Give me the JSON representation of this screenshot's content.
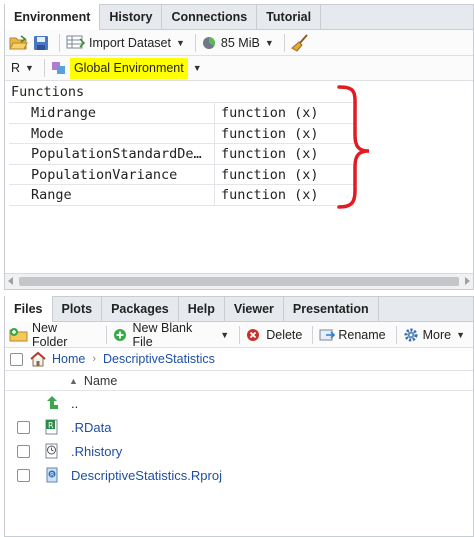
{
  "env_pane": {
    "tabs": [
      {
        "label": "Environment",
        "active": true
      },
      {
        "label": "History",
        "active": false
      },
      {
        "label": "Connections",
        "active": false
      },
      {
        "label": "Tutorial",
        "active": false
      }
    ],
    "toolbar": {
      "open_icon": "open-folder-icon",
      "save_icon": "save-icon",
      "import_label": "Import Dataset",
      "memory_label": "85 MiB",
      "broom_icon": "broom-icon"
    },
    "language_label": "R",
    "environment_label": "Global Environment",
    "section_header": "Functions",
    "objects": [
      {
        "name": "Midrange",
        "value": "function (x)"
      },
      {
        "name": "Mode",
        "value": "function (x)"
      },
      {
        "name": "PopulationStandardDe…",
        "value": "function (x)"
      },
      {
        "name": "PopulationVariance",
        "value": "function (x)"
      },
      {
        "name": "Range",
        "value": "function (x)"
      }
    ],
    "annotation_color": "#e11b22",
    "highlight_color": "#ffff00"
  },
  "files_pane": {
    "tabs": [
      {
        "label": "Files",
        "active": true
      },
      {
        "label": "Plots",
        "active": false
      },
      {
        "label": "Packages",
        "active": false
      },
      {
        "label": "Help",
        "active": false
      },
      {
        "label": "Viewer",
        "active": false
      },
      {
        "label": "Presentation",
        "active": false
      }
    ],
    "toolbar": {
      "new_folder": "New Folder",
      "new_blank_file": "New Blank File",
      "delete": "Delete",
      "rename": "Rename",
      "more": "More"
    },
    "breadcrumb": [
      "Home",
      "DescriptiveStatistics"
    ],
    "column_name": "Name",
    "files": [
      {
        "name": "..",
        "icon": "up-arrow-icon",
        "checkbox": false
      },
      {
        "name": ".RData",
        "icon": "rdata-file-icon",
        "checkbox": true
      },
      {
        "name": ".Rhistory",
        "icon": "history-file-icon",
        "checkbox": true
      },
      {
        "name": "DescriptiveStatistics.Rproj",
        "icon": "rproj-file-icon",
        "checkbox": true
      }
    ]
  }
}
